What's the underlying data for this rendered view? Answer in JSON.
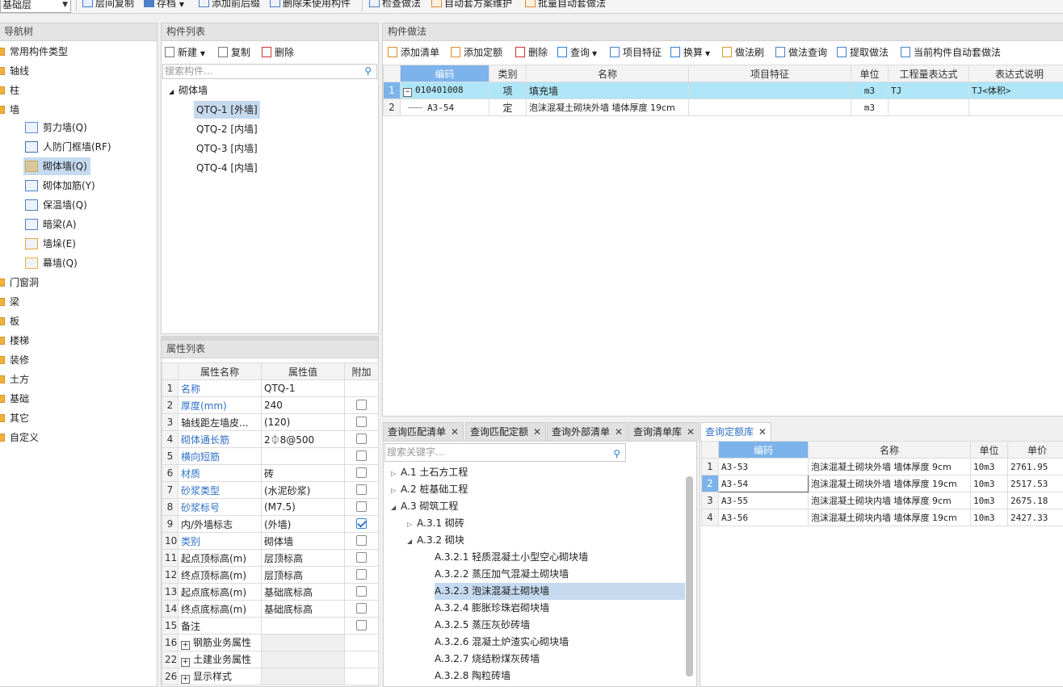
{
  "toolbar": {
    "floor_select": "基础层",
    "items": [
      {
        "label": "层间复制"
      },
      {
        "label": "存档"
      },
      {
        "label": "添加前后缀"
      },
      {
        "label": "删除未使用构件"
      },
      {
        "label": "检查做法"
      },
      {
        "label": "自动套方案维护"
      },
      {
        "label": "批量自动套做法"
      }
    ]
  },
  "nav": {
    "title": "导航树",
    "items": [
      "常用构件类型",
      "轴线",
      "柱",
      "墙"
    ],
    "wall_children": [
      "剪力墙(Q)",
      "人防门框墙(RF)",
      "砌体墙(Q)",
      "砌体加筋(Y)",
      "保温墙(Q)",
      "暗梁(A)",
      "墙垛(E)",
      "幕墙(Q)"
    ],
    "rest": [
      "门窗洞",
      "梁",
      "板",
      "楼梯",
      "装修",
      "土方",
      "基础",
      "其它",
      "自定义"
    ]
  },
  "complist": {
    "title": "构件列表",
    "new_label": "新建",
    "copy_label": "复制",
    "delete_label": "删除",
    "search_placeholder": "搜索构件...",
    "root": "砌体墙",
    "items": [
      "QTQ-1 [外墙]",
      "QTQ-2 [内墙]",
      "QTQ-3 [内墙]",
      "QTQ-4 [内墙]"
    ]
  },
  "props": {
    "title": "属性列表",
    "headers": [
      "属性名称",
      "属性值",
      "附加"
    ],
    "rows": [
      {
        "n": "1",
        "name": "名称",
        "value": "QTQ-1",
        "blue": true,
        "chk": "none"
      },
      {
        "n": "2",
        "name": "厚度(mm)",
        "value": "240",
        "blue": true,
        "chk": "off"
      },
      {
        "n": "3",
        "name": "轴线距左墙皮...",
        "value": "(120)",
        "blue": false,
        "chk": "off"
      },
      {
        "n": "4",
        "name": "砌体通长筋",
        "value": "2⏀8@500",
        "blue": true,
        "chk": "off"
      },
      {
        "n": "5",
        "name": "横向短筋",
        "value": "",
        "blue": true,
        "chk": "off"
      },
      {
        "n": "6",
        "name": "材质",
        "value": "砖",
        "blue": true,
        "chk": "off"
      },
      {
        "n": "7",
        "name": "砂浆类型",
        "value": "(水泥砂浆)",
        "blue": true,
        "chk": "off"
      },
      {
        "n": "8",
        "name": "砂浆标号",
        "value": "(M7.5)",
        "blue": true,
        "chk": "off"
      },
      {
        "n": "9",
        "name": "内/外墙标志",
        "value": "(外墙)",
        "blue": false,
        "chk": "on"
      },
      {
        "n": "10",
        "name": "类别",
        "value": "砌体墙",
        "blue": true,
        "chk": "off"
      },
      {
        "n": "11",
        "name": "起点顶标高(m)",
        "value": "层顶标高",
        "blue": false,
        "chk": "off"
      },
      {
        "n": "12",
        "name": "终点顶标高(m)",
        "value": "层顶标高",
        "blue": false,
        "chk": "off"
      },
      {
        "n": "13",
        "name": "起点底标高(m)",
        "value": "基础底标高",
        "blue": false,
        "chk": "off"
      },
      {
        "n": "14",
        "name": "终点底标高(m)",
        "value": "基础底标高",
        "blue": false,
        "chk": "off"
      },
      {
        "n": "15",
        "name": "备注",
        "value": "",
        "blue": false,
        "chk": "off"
      },
      {
        "n": "16",
        "name": "钢筋业务属性",
        "value": "",
        "blue": false,
        "chk": "group"
      },
      {
        "n": "22",
        "name": "土建业务属性",
        "value": "",
        "blue": false,
        "chk": "group"
      },
      {
        "n": "26",
        "name": "显示样式",
        "value": "",
        "blue": false,
        "chk": "group"
      }
    ]
  },
  "method": {
    "title": "构件做法",
    "toolbar": [
      "添加清单",
      "添加定额",
      "删除",
      "查询",
      "项目特征",
      "换算",
      "做法刷",
      "做法查询",
      "提取做法",
      "当前构件自动套做法"
    ],
    "headers": [
      "编码",
      "类别",
      "名称",
      "项目特征",
      "单位",
      "工程量表达式",
      "表达式说明"
    ],
    "rows": [
      {
        "n": "1",
        "code": "010401008",
        "type": "项",
        "name": "填充墙",
        "feature": "",
        "unit": "m3",
        "expr": "TJ",
        "desc": "TJ<体积>"
      },
      {
        "n": "2",
        "code": "A3-54",
        "type": "定",
        "name": "泡沫混凝土砌块外墙 墙体厚度 19cm",
        "feature": "",
        "unit": "m3",
        "expr": "",
        "desc": ""
      }
    ]
  },
  "tabs": [
    {
      "label": "查询匹配清单"
    },
    {
      "label": "查询匹配定额"
    },
    {
      "label": "查询外部清单"
    },
    {
      "label": "查询清单库"
    },
    {
      "label": "查询定额库"
    }
  ],
  "query": {
    "search_placeholder": "搜索关键字...",
    "tree": [
      {
        "label": "A.1 土石方工程",
        "arrow": "▷"
      },
      {
        "label": "A.2 桩基础工程",
        "arrow": "▷"
      },
      {
        "label": "A.3 砌筑工程",
        "arrow": "◢"
      },
      {
        "label": "A.3.1 砌砖",
        "arrow": "▷"
      },
      {
        "label": "A.3.2 砌块",
        "arrow": "◢"
      },
      {
        "label": "A.3.2.1 轻质混凝土小型空心砌块墙",
        "arrow": ""
      },
      {
        "label": "A.3.2.2 蒸压加气混凝土砌块墙",
        "arrow": ""
      },
      {
        "label": "A.3.2.3 泡沫混凝土砌块墙",
        "arrow": ""
      },
      {
        "label": "A.3.2.4 膨胀珍珠岩砌块墙",
        "arrow": ""
      },
      {
        "label": "A.3.2.5 蒸压灰砂砖墙",
        "arrow": ""
      },
      {
        "label": "A.3.2.6 混凝土炉渣实心砌块墙",
        "arrow": ""
      },
      {
        "label": "A.3.2.7 烧结粉煤灰砖墙",
        "arrow": ""
      },
      {
        "label": "A.3.2.8 陶粒砖墙",
        "arrow": ""
      }
    ],
    "headers": [
      "编码",
      "名称",
      "单位",
      "单价"
    ],
    "rows": [
      {
        "n": "1",
        "code": "A3-53",
        "name": "泡沫混凝土砌块外墙 墙体厚度 9cm",
        "unit": "10m3",
        "price": "2761.95"
      },
      {
        "n": "2",
        "code": "A3-54",
        "name": "泡沫混凝土砌块外墙 墙体厚度 19cm",
        "unit": "10m3",
        "price": "2517.53"
      },
      {
        "n": "3",
        "code": "A3-55",
        "name": "泡沫混凝土砌块内墙 墙体厚度 9cm",
        "unit": "10m3",
        "price": "2675.18"
      },
      {
        "n": "4",
        "code": "A3-56",
        "name": "泡沫混凝土砌块内墙 墙体厚度 19cm",
        "unit": "10m3",
        "price": "2427.33"
      }
    ]
  }
}
